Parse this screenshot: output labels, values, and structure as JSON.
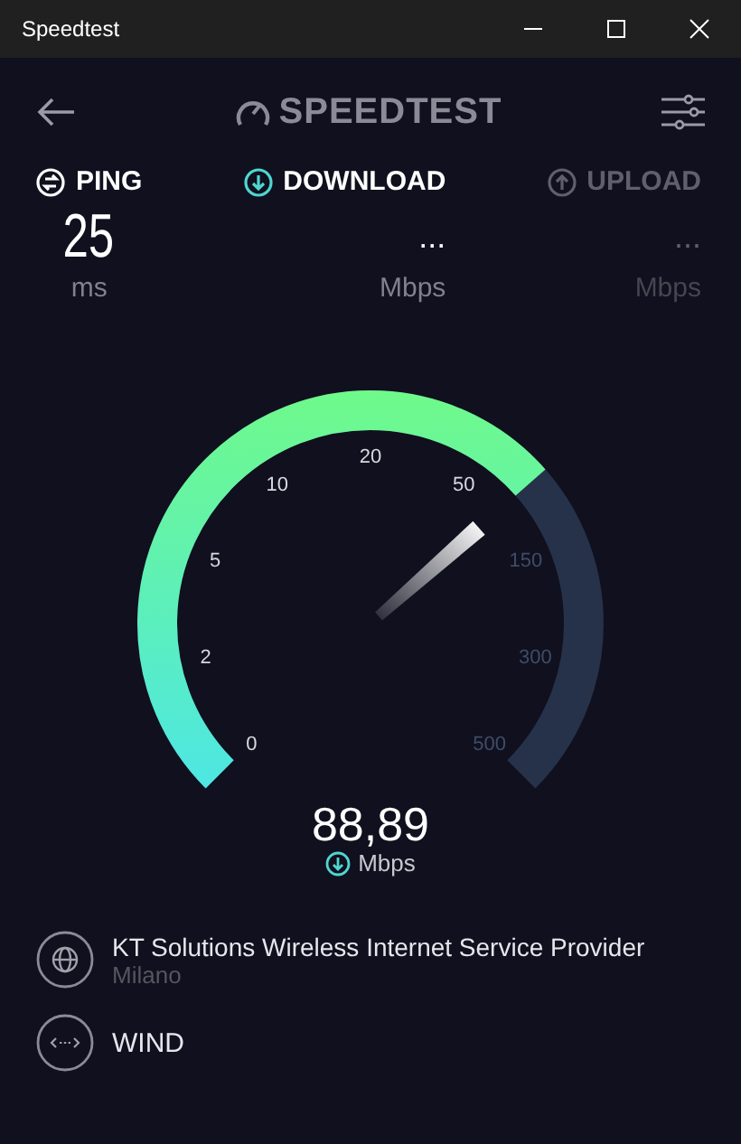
{
  "window": {
    "title": "Speedtest"
  },
  "header": {
    "logo": "SPEEDTEST"
  },
  "metrics": [
    {
      "kind": "ping",
      "label": "PING",
      "value": "25",
      "unit": "ms",
      "active": false,
      "disabled": false
    },
    {
      "kind": "download",
      "label": "DOWNLOAD",
      "value": "...",
      "unit": "Mbps",
      "active": true,
      "disabled": false
    },
    {
      "kind": "upload",
      "label": "UPLOAD",
      "value": "...",
      "unit": "Mbps",
      "active": false,
      "disabled": true
    }
  ],
  "gauge": {
    "ticks": [
      {
        "label": "0",
        "reached": true
      },
      {
        "label": "2",
        "reached": true
      },
      {
        "label": "5",
        "reached": true
      },
      {
        "label": "10",
        "reached": true
      },
      {
        "label": "20",
        "reached": true
      },
      {
        "label": "50",
        "reached": true
      },
      {
        "label": "150",
        "reached": false
      },
      {
        "label": "300",
        "reached": false
      },
      {
        "label": "500",
        "reached": false
      }
    ],
    "reading": "88,89",
    "unit": "Mbps"
  },
  "connection": [
    {
      "kind": "server",
      "name": "KT Solutions Wireless Internet Service Provider",
      "location": "Milano"
    },
    {
      "kind": "network",
      "name": "WIND"
    }
  ]
}
